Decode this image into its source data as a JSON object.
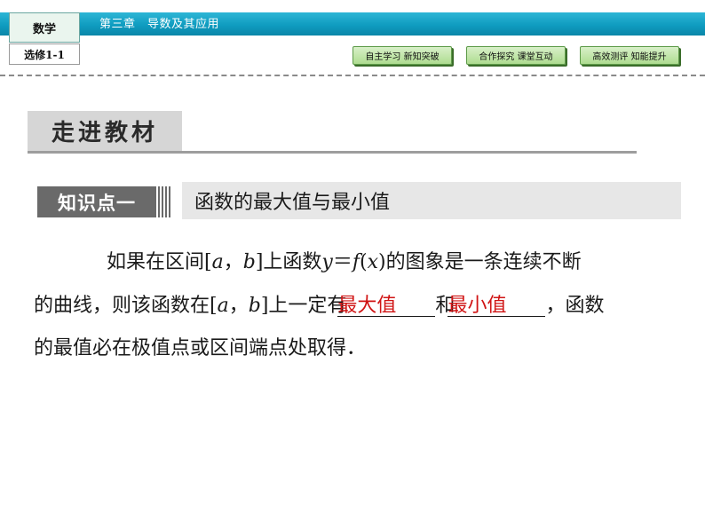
{
  "header": {
    "subject": "数学",
    "module": "选修1-1",
    "chapter": "第三章　导数及其应用",
    "nav": [
      "自主学习 新知突破",
      "合作探究 课堂互动",
      "高效测评 知能提升"
    ]
  },
  "section": {
    "title": "走进教材"
  },
  "knowledge_point": {
    "label": "知识点一",
    "title": "函数的最大值与最小值"
  },
  "paragraph": {
    "l1_a": "如果在区间[",
    "var_a": "a",
    "comma": "，",
    "var_b": "b",
    "l1_b": "]上函数",
    "var_y": "y",
    "eq": "＝",
    "var_f": "f",
    "paren_open": "(",
    "var_x": "x",
    "paren_close": ")",
    "l1_c": "的图象是一条连续不断",
    "l2_a": "的曲线，则该函数在[",
    "l2_b": "]上一定有",
    "answer_max": "最大值",
    "l2_c": "和",
    "answer_min": "最小值",
    "l2_d": "，函数",
    "l3": "的最值必在极值点或区间端点处取得．"
  },
  "colors": {
    "header_blue": "#0f9cc0",
    "nav_green": "#aedc90",
    "answer_red": "#d01414",
    "label_gray": "#6a6a6a"
  }
}
